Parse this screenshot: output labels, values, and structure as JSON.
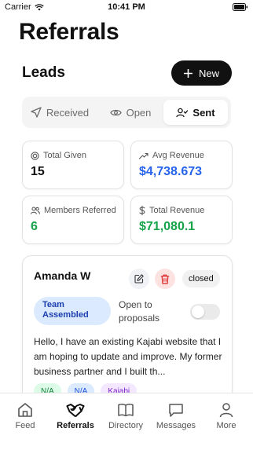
{
  "status_bar": {
    "carrier": "Carrier",
    "time": "10:41 PM"
  },
  "page_title": "Referrals",
  "leads": {
    "title": "Leads",
    "new_label": "New"
  },
  "tabs": [
    {
      "label": "Received",
      "icon": "send-icon",
      "active": false
    },
    {
      "label": "Open",
      "icon": "eye-icon",
      "active": false
    },
    {
      "label": "Sent",
      "icon": "user-check-icon",
      "active": true
    }
  ],
  "stats": [
    {
      "label": "Total Given",
      "value": "15",
      "icon": "target-icon",
      "color": "#111111"
    },
    {
      "label": "Avg Revenue",
      "value": "$4,738.673",
      "icon": "trending-up-icon",
      "color": "#2563eb"
    },
    {
      "label": "Members Referred",
      "value": "6",
      "icon": "users-icon",
      "color": "#16a34a"
    },
    {
      "label": "Total Revenue",
      "value": "$71,080.1",
      "icon": "dollar-icon",
      "color": "#16a34a"
    }
  ],
  "lead_card": {
    "name": "Amanda W",
    "status": "closed",
    "team_badge": "Team Assembled",
    "open_label": "Open to proposals",
    "open_to_proposals": false,
    "message": "Hello, I have an existing Kajabi website that I am hoping to update and improve. My former business partner and I built th...",
    "tags": [
      {
        "label": "N/A",
        "bg": "#dcfce7",
        "fg": "#15803d"
      },
      {
        "label": "N/A",
        "bg": "#dbeafe",
        "fg": "#1d4ed8"
      },
      {
        "label": "Kajabi",
        "bg": "#f3e8ff",
        "fg": "#7e22ce"
      }
    ]
  },
  "tabbar": [
    {
      "label": "Feed",
      "icon": "home-icon",
      "active": false
    },
    {
      "label": "Referrals",
      "icon": "handshake-icon",
      "active": true
    },
    {
      "label": "Directory",
      "icon": "book-icon",
      "active": false
    },
    {
      "label": "Messages",
      "icon": "message-icon",
      "active": false
    },
    {
      "label": "More",
      "icon": "person-icon",
      "active": false
    }
  ],
  "colors": {
    "accent": "#111111",
    "blue": "#2563eb",
    "green": "#16a34a",
    "delete": "#dc2626"
  }
}
